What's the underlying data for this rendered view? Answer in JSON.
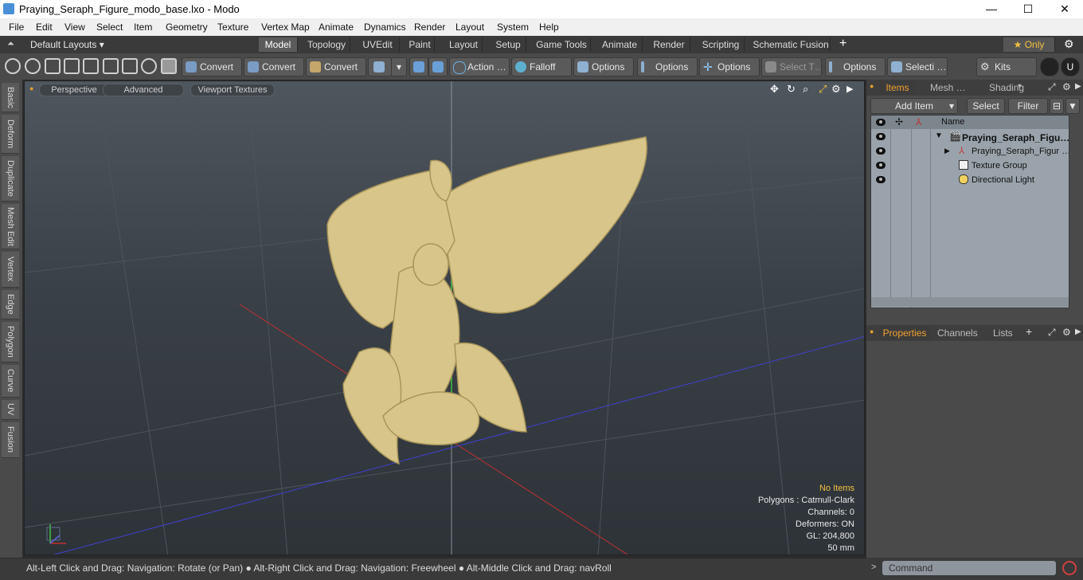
{
  "window": {
    "title": "Praying_Seraph_Figure_modo_base.lxo - Modo",
    "minimize": "—",
    "maximize": "☐",
    "close": "✕"
  },
  "menu": [
    "File",
    "Edit",
    "View",
    "Select",
    "Item",
    "Geometry",
    "Texture",
    "Vertex Map",
    "Animate",
    "Dynamics",
    "Render",
    "Layout",
    "System",
    "Help"
  ],
  "layouts": {
    "default_layouts": "Default Layouts ▾",
    "tabs": [
      "Model",
      "Topology",
      "UVEdit",
      "Paint",
      "Layout",
      "Setup",
      "Game Tools",
      "Animate",
      "Render",
      "Scripting",
      "Schematic Fusion"
    ],
    "active": "Model",
    "add": "+",
    "only": "★ Only",
    "gear": "⚙"
  },
  "toolbar": {
    "buttons": [
      "Convert",
      "Convert",
      "Convert",
      "Action …",
      "Falloff",
      "Options",
      "Options",
      "Options",
      "Select T…",
      "Options",
      "Selecti …",
      "Kits"
    ]
  },
  "left_tabs": [
    "Basic",
    "Deform",
    "Duplicate",
    "Mesh Edit",
    "Vertex",
    "Edge",
    "Polygon",
    "Curve",
    "UV",
    "Fusion"
  ],
  "viewport": {
    "view_mode": "Perspective",
    "shading": "Advanced",
    "textures": "Viewport Textures",
    "info": {
      "items": "No Items",
      "polygons": "Polygons : Catmull-Clark",
      "channels": "Channels: 0",
      "deformers": "Deformers: ON",
      "gl": "GL: 204,800",
      "scale": "50 mm"
    }
  },
  "status": {
    "hint": "Alt-Left Click and Drag: Navigation: Rotate (or Pan) ● Alt-Right Click and Drag: Navigation: Freewheel ● Alt-Middle Click and Drag: navRoll"
  },
  "items_panel": {
    "tabs": [
      "Items",
      "Mesh …",
      "Shading"
    ],
    "active": "Items",
    "add_item": "Add Item",
    "select": "Select",
    "filter": "Filter",
    "column_name": "Name",
    "rows": [
      {
        "name": "Praying_Seraph_Figu…",
        "bold": true
      },
      {
        "name": "Praying_Seraph_Figur …",
        "bold": false
      },
      {
        "name": "Texture Group",
        "bold": false
      },
      {
        "name": "Directional Light",
        "bold": false
      }
    ]
  },
  "props_panel": {
    "tabs": [
      "Properties",
      "Channels",
      "Lists"
    ],
    "active": "Properties",
    "add": "+"
  },
  "command": {
    "placeholder": "Command"
  },
  "colors": {
    "accent": "#f0a030",
    "mesh": "#d8c58a",
    "axis_x": "#c03030",
    "axis_y": "#40c040",
    "axis_z": "#4040d0"
  }
}
